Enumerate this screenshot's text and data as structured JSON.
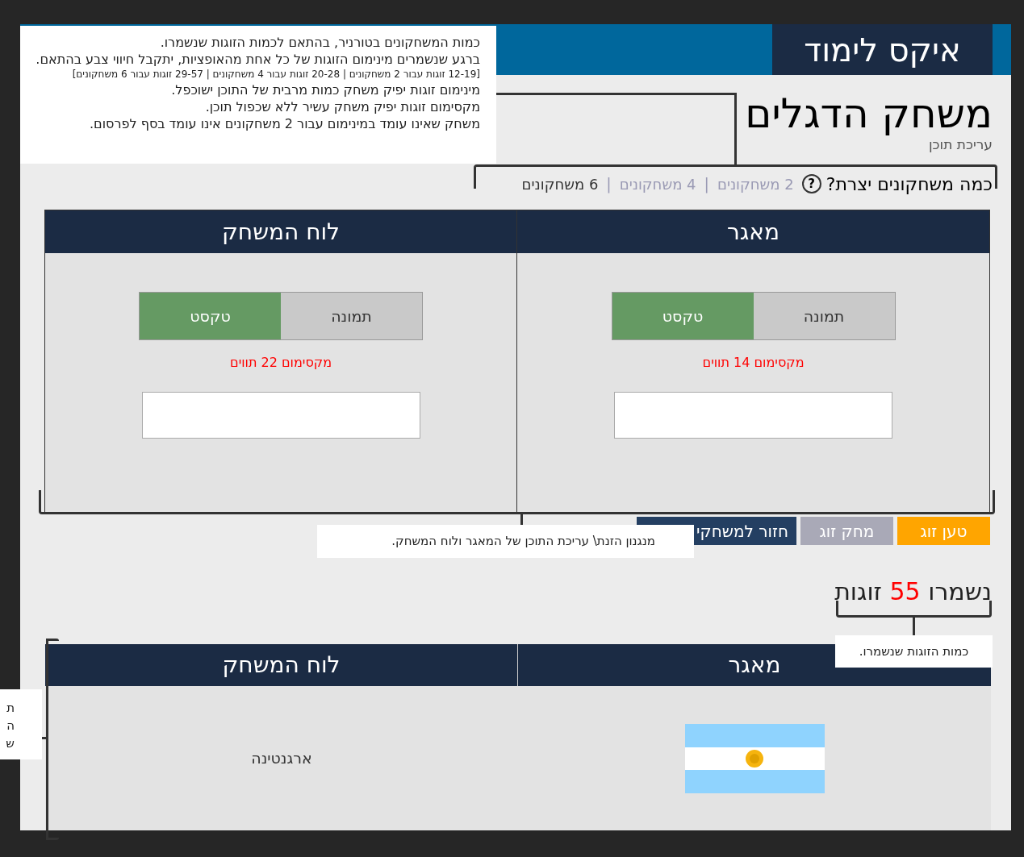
{
  "app": {
    "logo": "איקס לימוד",
    "title": "משחק הדגלים",
    "subtitle": "עריכת תוכן",
    "question": "כמה משחקונים יצרת?",
    "help_icon": "?",
    "separator": "|",
    "modes": [
      {
        "label": "2 משחקונים",
        "selected": false
      },
      {
        "label": "4 משחקונים",
        "selected": false
      },
      {
        "label": "6 משחקונים",
        "selected": true
      }
    ],
    "editor": [
      {
        "title": "מאגר",
        "toggles": [
          {
            "label": "תמונה",
            "selected": false
          },
          {
            "label": "טקסט",
            "selected": true
          }
        ],
        "limit": "מקסימום 14 תווים"
      },
      {
        "title": "לוח המשחק",
        "toggles": [
          {
            "label": "תמונה",
            "selected": false
          },
          {
            "label": "טקסט",
            "selected": true
          }
        ],
        "limit": "מקסימום 22 תווים"
      }
    ],
    "actions": [
      {
        "label": "טען זוג",
        "color": "#ffa500"
      },
      {
        "label": "מחק זוג",
        "color": "#a9a9b7"
      },
      {
        "label": "חזור למשחקי",
        "color": "#243f62"
      }
    ],
    "remaining": {
      "before": "נשמרו",
      "count": "55",
      "after": "זוגות"
    },
    "table": {
      "columns": [
        "מאגר",
        "לוח המשחק"
      ],
      "rows": [
        {
          "name": "ארגנטינה"
        }
      ]
    }
  },
  "notes": {
    "top": [
      {
        "text": "כמות המשחקונים בטורניר, בהתאם לכמות הזוגות שנשמרו.",
        "kind": "normal"
      },
      {
        "text": "ברגע שנשמרים מינימום הזוגות של כל אחת מהאופציות, יתקבל חיווי צבע בהתאם.",
        "kind": "normal"
      },
      {
        "text": "[12-19 זוגות עבור 2 משחקונים | 20-28 זוגות עבור 4 משחקונים | 29-57 זוגות עבור 6 משחקונים]",
        "kind": "small"
      },
      {
        "text": "מינימום זוגות יפיק משחק כמות מרבית של התוכן ישוכפל.",
        "kind": "normal"
      },
      {
        "text": "מקסימום זוגות יפיק משחק עשיר ללא שכפול תוכן.",
        "kind": "normal"
      },
      {
        "text": "משחק שאינו עומד במינימום עבור 2 משחקונים אינו עומד בסף לפרסום.",
        "kind": "normal"
      }
    ],
    "editor": "מנגנון הזנת\\ עריכת התוכן של המאגר ולוח המשחק.",
    "pairs": "כמות הזוגות שנשמרו.",
    "side": [
      "ת",
      "ה",
      "ש"
    ]
  }
}
